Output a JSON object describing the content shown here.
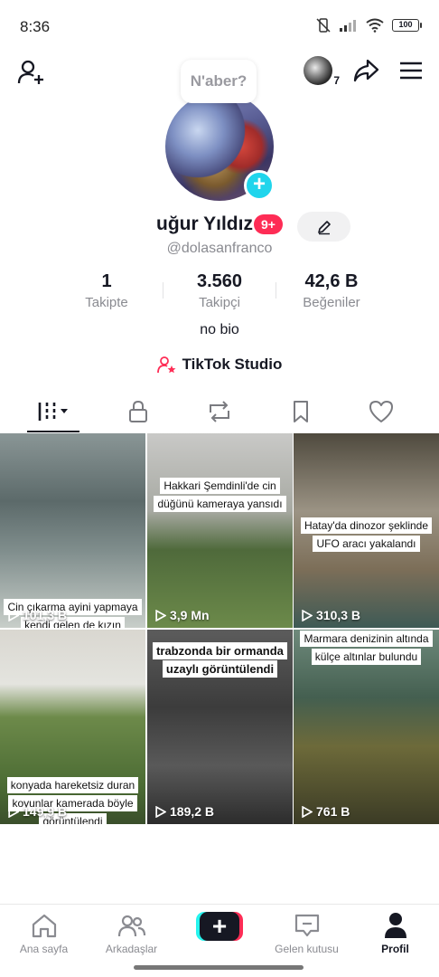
{
  "status_bar": {
    "time": "8:36",
    "battery": "100"
  },
  "profile": {
    "bubble_text": "N'aber?",
    "name": "uğur Yıldız",
    "badge": "9+",
    "handle": "@dolasanfranco",
    "bio": "no bio",
    "studio_label": "TikTok Studio",
    "mini_avatar_count": "7"
  },
  "stats": [
    {
      "value": "1",
      "label": "Takipte"
    },
    {
      "value": "3.560",
      "label": "Takipçi"
    },
    {
      "value": "42,6 B",
      "label": "Beğeniler"
    }
  ],
  "tabs": [
    "videos",
    "private",
    "reposts",
    "favorites",
    "liked"
  ],
  "videos": [
    {
      "caption": "Cin çıkarma ayini yapmaya kendi gelen de kızın yakınları, kızın içindeki cini hareketlendirin",
      "views": "101,3 B"
    },
    {
      "caption": "Hakkari Şemdinli'de cin düğünü kameraya yansıdı",
      "views": "3,9 Mn"
    },
    {
      "caption": "Hatay'da dinozor şeklinde UFO aracı yakalandı",
      "views": "310,3 B"
    },
    {
      "caption": "konyada hareketsiz duran koyunlar kamerada böyle görüntülendi",
      "views": "149,9 B"
    },
    {
      "caption": "trabzonda bir ormanda uzaylı görüntülendi",
      "views": "189,2 B"
    },
    {
      "caption": "Marmara denizinin altında külçe altınlar bulundu",
      "views": "761 B"
    }
  ],
  "bottom_nav": {
    "home": "Ana sayfa",
    "friends": "Arkadaşlar",
    "inbox": "Gelen kutusu",
    "profile": "Profil"
  },
  "colors": {
    "accent": "#fe2c55",
    "cyan": "#25f4ee",
    "add": "#20d5ec",
    "text": "#161823",
    "muted": "#8a8b91"
  }
}
